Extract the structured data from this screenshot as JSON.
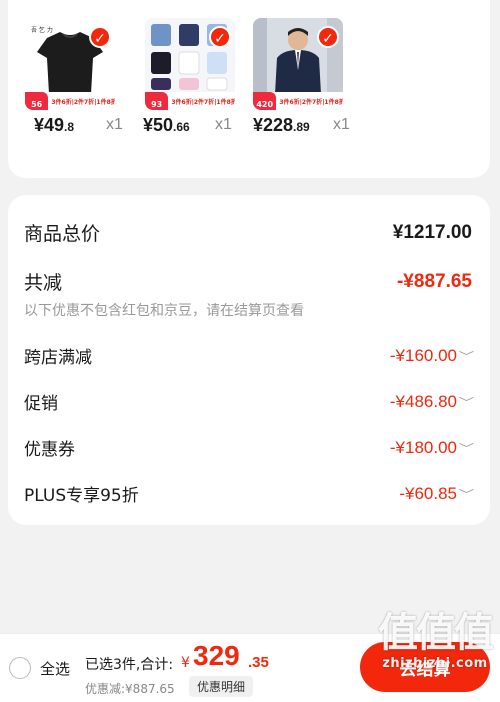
{
  "products": [
    {
      "name": "black-tshirt",
      "promo_price": "56",
      "promo_text": "3件6折|2件7折|1件8折",
      "price_int": "¥49",
      "price_dec": ".8",
      "qty": "x1",
      "colors": [
        "#222222",
        "#3a3a3a"
      ]
    },
    {
      "name": "shirts-set",
      "promo_price": "93",
      "promo_text": "3件6折|2件7折|1件8折",
      "price_int": "¥50",
      "price_dec": ".66",
      "qty": "x1",
      "colors": [
        "#5b7fb6",
        "#e9eef7"
      ]
    },
    {
      "name": "mens-blazer",
      "promo_price": "420",
      "promo_text": "3件6折|2件7折|1件8折",
      "price_int": "¥228",
      "price_dec": ".89",
      "qty": "x1",
      "colors": [
        "#1f2a44",
        "#c7ccd5"
      ]
    }
  ],
  "summary": {
    "total_label": "商品总价",
    "total_value": "¥1217.00",
    "reduce_label": "共减",
    "reduce_value": "-¥887.65",
    "note": "以下优惠不包含红包和京豆，请在结算页查看",
    "items": [
      {
        "label": "跨店满减",
        "value": "-¥160.00"
      },
      {
        "label": "促销",
        "value": "-¥486.80"
      },
      {
        "label": "优惠券",
        "value": "-¥180.00"
      },
      {
        "label": "PLUS专享95折",
        "value": "-¥60.85"
      }
    ]
  },
  "bottom": {
    "select_all": "全选",
    "selected_info": "已选3件,合计:",
    "currency": "¥",
    "sum_int": "329",
    "sum_dec": ".35",
    "discount": "优惠减:¥887.65",
    "detail_button": "优惠明细",
    "checkout_button": "去结算"
  },
  "watermark": {
    "big": "值值值",
    "small": "zhizhizhi.com"
  },
  "accent_color": "#f2270c"
}
